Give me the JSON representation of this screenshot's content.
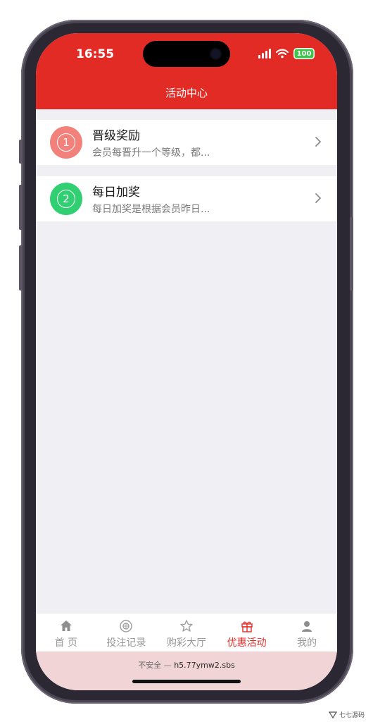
{
  "status_bar": {
    "time": "16:55",
    "battery": "100"
  },
  "header": {
    "title": "活动中心"
  },
  "activities": [
    {
      "number": "1",
      "title": "晋级奖励",
      "description": "会员每晋升一个等级，都...",
      "color": "#f2817b"
    },
    {
      "number": "2",
      "title": "每日加奖",
      "description": "每日加奖是根据会员昨日...",
      "color": "#2fcf72"
    }
  ],
  "tabbar": {
    "items": [
      {
        "label": "首 页",
        "icon": "home-icon"
      },
      {
        "label": "投注记录",
        "icon": "bet-record-icon"
      },
      {
        "label": "购彩大厅",
        "icon": "lottery-hall-icon"
      },
      {
        "label": "优惠活动",
        "icon": "gift-icon",
        "active": true
      },
      {
        "label": "我的",
        "icon": "user-icon"
      }
    ]
  },
  "url_bar": {
    "security": "不安全 —",
    "host": "h5.77ymw2.sbs"
  },
  "watermark": "七七源码",
  "colors": {
    "brand_red": "#e32b26",
    "inactive_gray": "#9a9a9a"
  }
}
